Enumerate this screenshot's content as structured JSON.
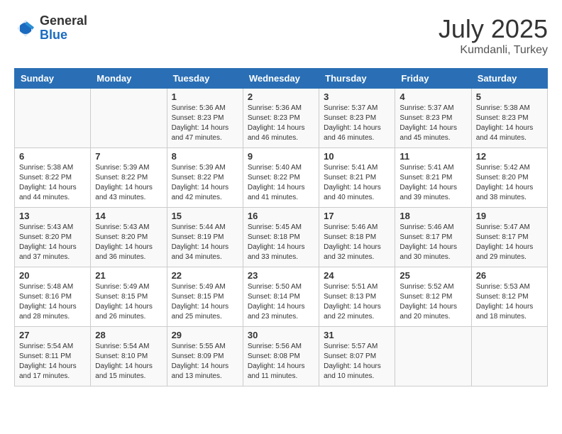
{
  "logo": {
    "general": "General",
    "blue": "Blue"
  },
  "title": {
    "month_year": "July 2025",
    "location": "Kumdanli, Turkey"
  },
  "weekdays": [
    "Sunday",
    "Monday",
    "Tuesday",
    "Wednesday",
    "Thursday",
    "Friday",
    "Saturday"
  ],
  "weeks": [
    [
      {
        "day": "",
        "sunrise": "",
        "sunset": "",
        "daylight": ""
      },
      {
        "day": "",
        "sunrise": "",
        "sunset": "",
        "daylight": ""
      },
      {
        "day": "1",
        "sunrise": "Sunrise: 5:36 AM",
        "sunset": "Sunset: 8:23 PM",
        "daylight": "Daylight: 14 hours and 47 minutes."
      },
      {
        "day": "2",
        "sunrise": "Sunrise: 5:36 AM",
        "sunset": "Sunset: 8:23 PM",
        "daylight": "Daylight: 14 hours and 46 minutes."
      },
      {
        "day": "3",
        "sunrise": "Sunrise: 5:37 AM",
        "sunset": "Sunset: 8:23 PM",
        "daylight": "Daylight: 14 hours and 46 minutes."
      },
      {
        "day": "4",
        "sunrise": "Sunrise: 5:37 AM",
        "sunset": "Sunset: 8:23 PM",
        "daylight": "Daylight: 14 hours and 45 minutes."
      },
      {
        "day": "5",
        "sunrise": "Sunrise: 5:38 AM",
        "sunset": "Sunset: 8:23 PM",
        "daylight": "Daylight: 14 hours and 44 minutes."
      }
    ],
    [
      {
        "day": "6",
        "sunrise": "Sunrise: 5:38 AM",
        "sunset": "Sunset: 8:22 PM",
        "daylight": "Daylight: 14 hours and 44 minutes."
      },
      {
        "day": "7",
        "sunrise": "Sunrise: 5:39 AM",
        "sunset": "Sunset: 8:22 PM",
        "daylight": "Daylight: 14 hours and 43 minutes."
      },
      {
        "day": "8",
        "sunrise": "Sunrise: 5:39 AM",
        "sunset": "Sunset: 8:22 PM",
        "daylight": "Daylight: 14 hours and 42 minutes."
      },
      {
        "day": "9",
        "sunrise": "Sunrise: 5:40 AM",
        "sunset": "Sunset: 8:22 PM",
        "daylight": "Daylight: 14 hours and 41 minutes."
      },
      {
        "day": "10",
        "sunrise": "Sunrise: 5:41 AM",
        "sunset": "Sunset: 8:21 PM",
        "daylight": "Daylight: 14 hours and 40 minutes."
      },
      {
        "day": "11",
        "sunrise": "Sunrise: 5:41 AM",
        "sunset": "Sunset: 8:21 PM",
        "daylight": "Daylight: 14 hours and 39 minutes."
      },
      {
        "day": "12",
        "sunrise": "Sunrise: 5:42 AM",
        "sunset": "Sunset: 8:20 PM",
        "daylight": "Daylight: 14 hours and 38 minutes."
      }
    ],
    [
      {
        "day": "13",
        "sunrise": "Sunrise: 5:43 AM",
        "sunset": "Sunset: 8:20 PM",
        "daylight": "Daylight: 14 hours and 37 minutes."
      },
      {
        "day": "14",
        "sunrise": "Sunrise: 5:43 AM",
        "sunset": "Sunset: 8:20 PM",
        "daylight": "Daylight: 14 hours and 36 minutes."
      },
      {
        "day": "15",
        "sunrise": "Sunrise: 5:44 AM",
        "sunset": "Sunset: 8:19 PM",
        "daylight": "Daylight: 14 hours and 34 minutes."
      },
      {
        "day": "16",
        "sunrise": "Sunrise: 5:45 AM",
        "sunset": "Sunset: 8:18 PM",
        "daylight": "Daylight: 14 hours and 33 minutes."
      },
      {
        "day": "17",
        "sunrise": "Sunrise: 5:46 AM",
        "sunset": "Sunset: 8:18 PM",
        "daylight": "Daylight: 14 hours and 32 minutes."
      },
      {
        "day": "18",
        "sunrise": "Sunrise: 5:46 AM",
        "sunset": "Sunset: 8:17 PM",
        "daylight": "Daylight: 14 hours and 30 minutes."
      },
      {
        "day": "19",
        "sunrise": "Sunrise: 5:47 AM",
        "sunset": "Sunset: 8:17 PM",
        "daylight": "Daylight: 14 hours and 29 minutes."
      }
    ],
    [
      {
        "day": "20",
        "sunrise": "Sunrise: 5:48 AM",
        "sunset": "Sunset: 8:16 PM",
        "daylight": "Daylight: 14 hours and 28 minutes."
      },
      {
        "day": "21",
        "sunrise": "Sunrise: 5:49 AM",
        "sunset": "Sunset: 8:15 PM",
        "daylight": "Daylight: 14 hours and 26 minutes."
      },
      {
        "day": "22",
        "sunrise": "Sunrise: 5:49 AM",
        "sunset": "Sunset: 8:15 PM",
        "daylight": "Daylight: 14 hours and 25 minutes."
      },
      {
        "day": "23",
        "sunrise": "Sunrise: 5:50 AM",
        "sunset": "Sunset: 8:14 PM",
        "daylight": "Daylight: 14 hours and 23 minutes."
      },
      {
        "day": "24",
        "sunrise": "Sunrise: 5:51 AM",
        "sunset": "Sunset: 8:13 PM",
        "daylight": "Daylight: 14 hours and 22 minutes."
      },
      {
        "day": "25",
        "sunrise": "Sunrise: 5:52 AM",
        "sunset": "Sunset: 8:12 PM",
        "daylight": "Daylight: 14 hours and 20 minutes."
      },
      {
        "day": "26",
        "sunrise": "Sunrise: 5:53 AM",
        "sunset": "Sunset: 8:12 PM",
        "daylight": "Daylight: 14 hours and 18 minutes."
      }
    ],
    [
      {
        "day": "27",
        "sunrise": "Sunrise: 5:54 AM",
        "sunset": "Sunset: 8:11 PM",
        "daylight": "Daylight: 14 hours and 17 minutes."
      },
      {
        "day": "28",
        "sunrise": "Sunrise: 5:54 AM",
        "sunset": "Sunset: 8:10 PM",
        "daylight": "Daylight: 14 hours and 15 minutes."
      },
      {
        "day": "29",
        "sunrise": "Sunrise: 5:55 AM",
        "sunset": "Sunset: 8:09 PM",
        "daylight": "Daylight: 14 hours and 13 minutes."
      },
      {
        "day": "30",
        "sunrise": "Sunrise: 5:56 AM",
        "sunset": "Sunset: 8:08 PM",
        "daylight": "Daylight: 14 hours and 11 minutes."
      },
      {
        "day": "31",
        "sunrise": "Sunrise: 5:57 AM",
        "sunset": "Sunset: 8:07 PM",
        "daylight": "Daylight: 14 hours and 10 minutes."
      },
      {
        "day": "",
        "sunrise": "",
        "sunset": "",
        "daylight": ""
      },
      {
        "day": "",
        "sunrise": "",
        "sunset": "",
        "daylight": ""
      }
    ]
  ]
}
